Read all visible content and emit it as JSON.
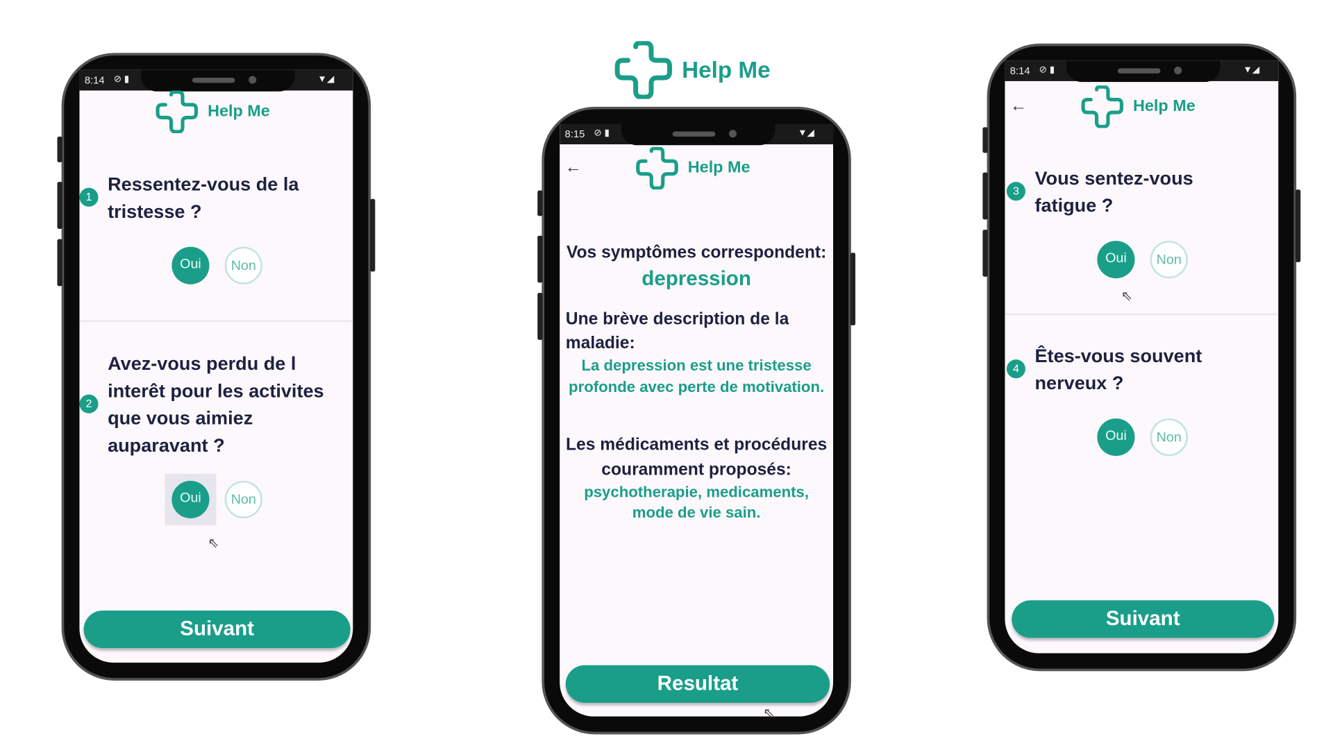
{
  "brand": {
    "name": "Help Me",
    "color": "#1a9e8a"
  },
  "phone1": {
    "time": "8:14",
    "q1": {
      "num": "1",
      "text": "Ressentez-vous de la tristesse ?",
      "yes": "Oui",
      "no": "Non"
    },
    "q2": {
      "num": "2",
      "text": "Avez-vous perdu de l interêt pour les activites que vous aimiez auparavant ?",
      "yes": "Oui",
      "no": "Non"
    },
    "next": "Suivant"
  },
  "phone2": {
    "time": "8:15",
    "match_label": "Vos symptômes correspondent:",
    "diagnosis": "depression",
    "desc_label_1": "Une brève description de la",
    "desc_label_2": "maladie:",
    "desc_1": "La depression est une tristesse",
    "desc_2": "profonde avec perte de motivation.",
    "treat_label_1": "Les médicaments et procédures",
    "treat_label_2": "couramment proposés:",
    "treat_1": "psychotherapie, medicaments,",
    "treat_2": "mode de vie sain.",
    "result": "Resultat"
  },
  "phone3": {
    "time": "8:14",
    "q3": {
      "num": "3",
      "text": "Vous sentez-vous fatigue ?",
      "yes": "Oui",
      "no": "Non"
    },
    "q4": {
      "num": "4",
      "text": "Êtes-vous souvent nerveux ?",
      "yes": "Oui",
      "no": "Non"
    },
    "next": "Suivant"
  }
}
